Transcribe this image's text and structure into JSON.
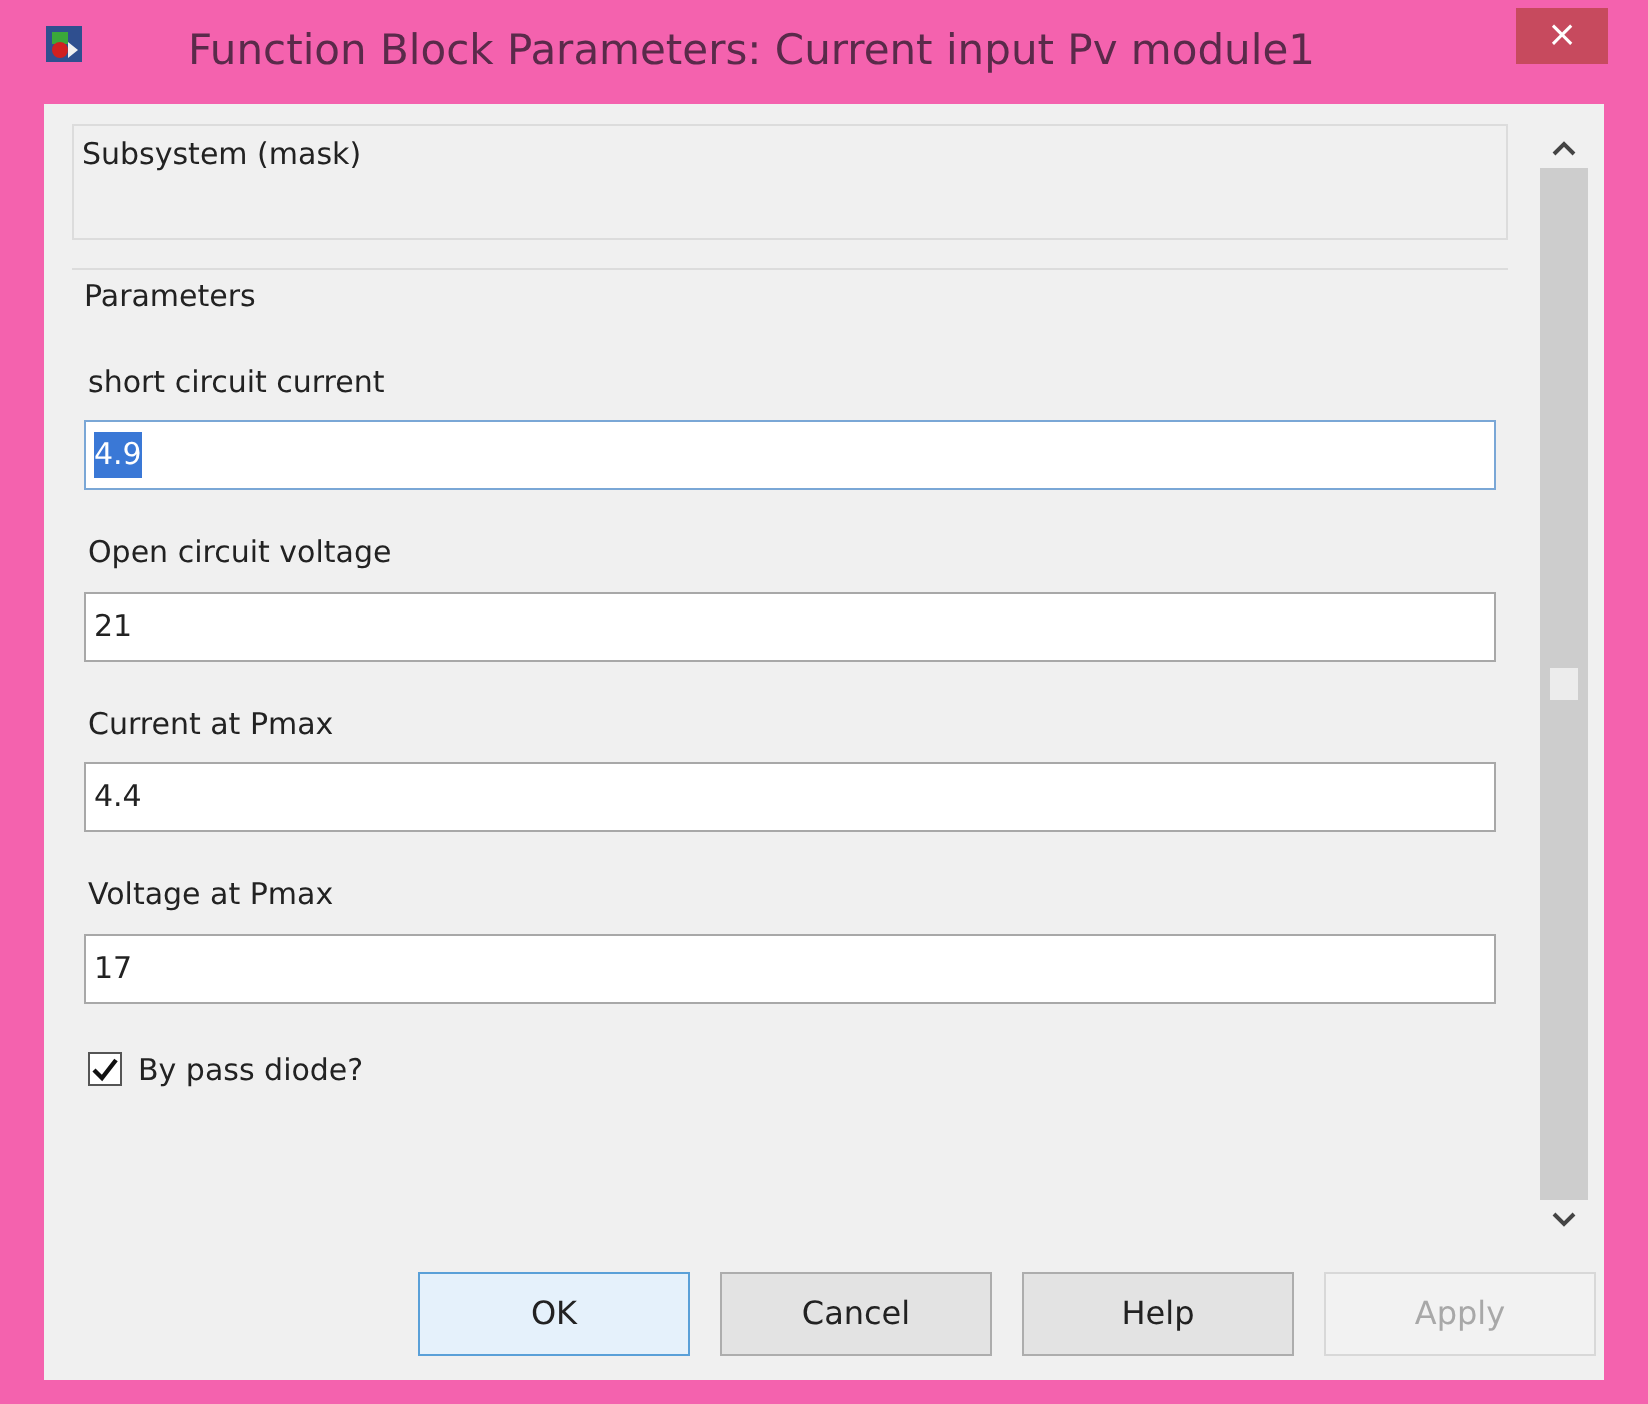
{
  "window": {
    "title": "Function Block Parameters: Current input Pv module1",
    "close": "×"
  },
  "subsystem": {
    "title": "Subsystem (mask)"
  },
  "parameters": {
    "title": "Parameters",
    "fields": [
      {
        "label": "short circuit current",
        "value": "4.9",
        "focused": true
      },
      {
        "label": "Open circuit voltage",
        "value": "21",
        "focused": false
      },
      {
        "label": "Current at Pmax",
        "value": "4.4",
        "focused": false
      },
      {
        "label": "Voltage at Pmax",
        "value": "17",
        "focused": false
      }
    ],
    "checkbox": {
      "label": "By pass diode?",
      "checked": true
    }
  },
  "buttons": [
    {
      "label": "OK",
      "default": true,
      "disabled": false
    },
    {
      "label": "Cancel",
      "default": false,
      "disabled": false
    },
    {
      "label": "Help",
      "default": false,
      "disabled": false
    },
    {
      "label": "Apply",
      "default": false,
      "disabled": true
    }
  ]
}
